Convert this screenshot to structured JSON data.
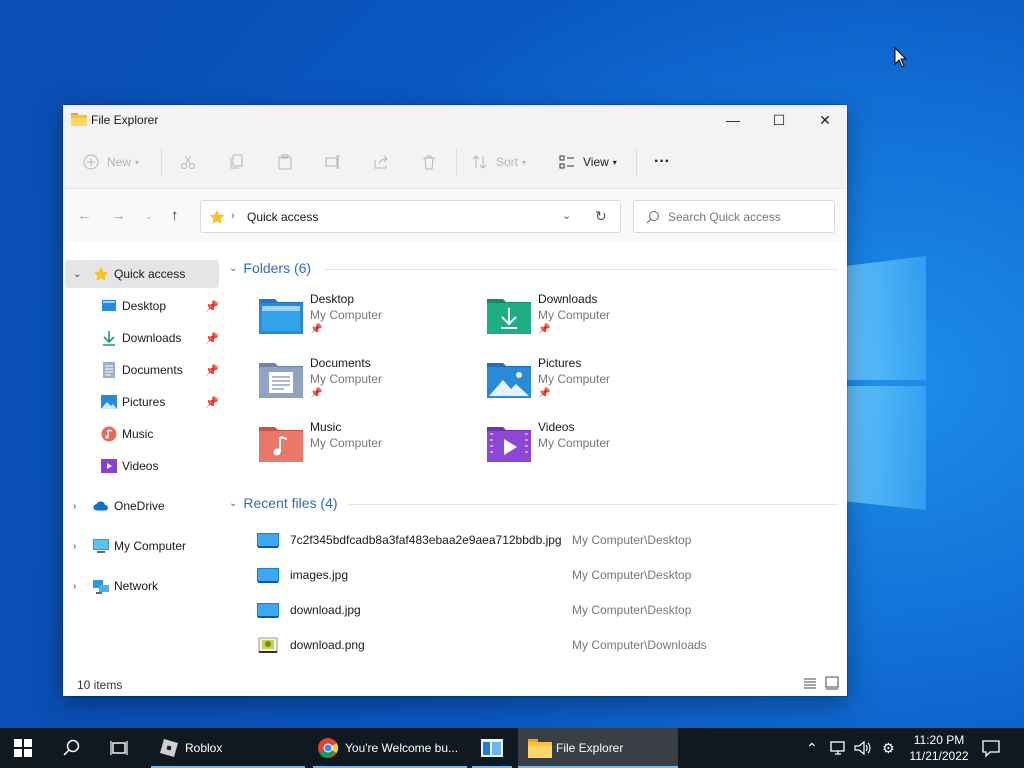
{
  "window": {
    "title": "File Explorer",
    "controls": {
      "minimize": "—",
      "maximize": "☐",
      "close": "✕"
    }
  },
  "toolbar": {
    "new_label": "New",
    "sort_label": "Sort",
    "view_label": "View",
    "more_label": "···"
  },
  "address": {
    "location": "Quick access",
    "search_placeholder": "Search Quick access"
  },
  "sidebar": {
    "items": [
      {
        "label": "Quick access",
        "icon": "star-icon",
        "selected": true
      },
      {
        "label": "Desktop",
        "icon": "desktop-icon",
        "pinned": true
      },
      {
        "label": "Downloads",
        "icon": "download-icon",
        "pinned": true
      },
      {
        "label": "Documents",
        "icon": "document-icon",
        "pinned": true
      },
      {
        "label": "Pictures",
        "icon": "pictures-icon",
        "pinned": true
      },
      {
        "label": "Music",
        "icon": "music-icon"
      },
      {
        "label": "Videos",
        "icon": "videos-icon"
      },
      {
        "label": "OneDrive",
        "icon": "cloud-icon"
      },
      {
        "label": "My Computer",
        "icon": "computer-icon"
      },
      {
        "label": "Network",
        "icon": "network-icon"
      }
    ]
  },
  "folders": {
    "heading": "Folders (6)",
    "items": [
      {
        "name": "Desktop",
        "location": "My Computer",
        "pinned": true,
        "icon": "desktop-folder-icon"
      },
      {
        "name": "Downloads",
        "location": "My Computer",
        "pinned": true,
        "icon": "downloads-folder-icon"
      },
      {
        "name": "Documents",
        "location": "My Computer",
        "pinned": true,
        "icon": "documents-folder-icon"
      },
      {
        "name": "Pictures",
        "location": "My Computer",
        "pinned": true,
        "icon": "pictures-folder-icon"
      },
      {
        "name": "Music",
        "location": "My Computer",
        "pinned": false,
        "icon": "music-folder-icon"
      },
      {
        "name": "Videos",
        "location": "My Computer",
        "pinned": false,
        "icon": "videos-folder-icon"
      }
    ]
  },
  "recent": {
    "heading": "Recent files (4)",
    "items": [
      {
        "name": "7c2f345bdfcadb8a3faf483ebaa2e9aea712bbdb.jpg",
        "path": "My Computer\\Desktop",
        "icon": "image-file-icon"
      },
      {
        "name": "images.jpg",
        "path": "My Computer\\Desktop",
        "icon": "image-file-icon"
      },
      {
        "name": "download.jpg",
        "path": "My Computer\\Desktop",
        "icon": "image-file-icon"
      },
      {
        "name": "download.png",
        "path": "My Computer\\Downloads",
        "icon": "png-file-icon"
      }
    ]
  },
  "status": {
    "item_count": "10 items"
  },
  "taskbar": {
    "apps": [
      {
        "label": "Roblox",
        "icon": "roblox-icon"
      },
      {
        "label": "You're Welcome bu...",
        "icon": "chrome-icon"
      },
      {
        "label": "",
        "icon": "app-window-icon"
      },
      {
        "label": "File Explorer",
        "icon": "file-explorer-icon",
        "active": true
      }
    ],
    "time": "11:20 PM",
    "date": "11/21/2022"
  },
  "colors": {
    "accent": "#2f6cb5",
    "desktop": "#0a58c2",
    "taskbar": "#101820"
  }
}
